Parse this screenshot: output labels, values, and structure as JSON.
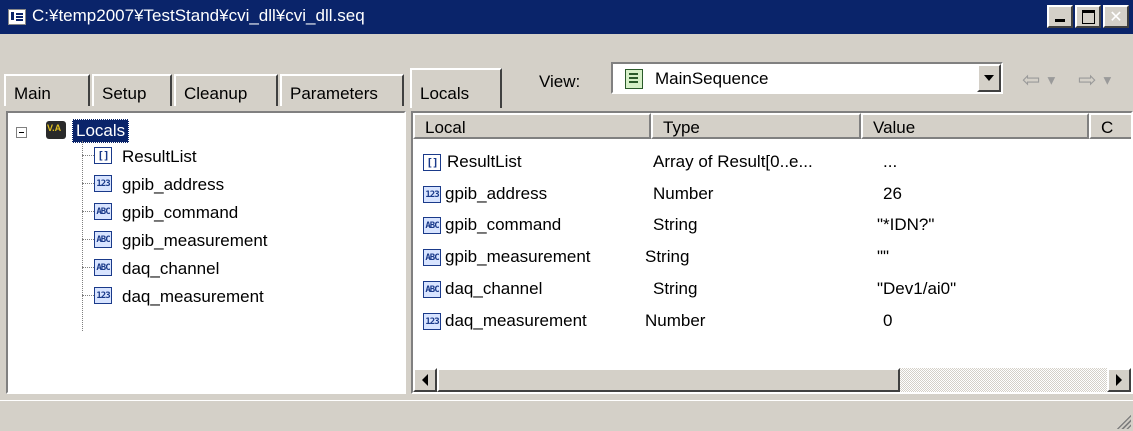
{
  "window": {
    "title": "C:¥temp2007¥TestStand¥cvi_dll¥cvi_dll.seq"
  },
  "tabs": [
    "Main",
    "Setup",
    "Cleanup",
    "Parameters",
    "Locals"
  ],
  "active_tab": "Locals",
  "view": {
    "label": "View:",
    "value": "MainSequence"
  },
  "tree": {
    "root_label": "Locals",
    "items": [
      {
        "label": "ResultList",
        "icon": "array-icon",
        "badge": "[]"
      },
      {
        "label": "gpib_address",
        "icon": "number-icon",
        "badge": "123"
      },
      {
        "label": "gpib_command",
        "icon": "string-icon",
        "badge": "ABC"
      },
      {
        "label": "gpib_measurement",
        "icon": "string-icon",
        "badge": "ABC"
      },
      {
        "label": "daq_channel",
        "icon": "string-icon",
        "badge": "ABC"
      },
      {
        "label": "daq_measurement",
        "icon": "number-icon",
        "badge": "123"
      }
    ]
  },
  "table": {
    "columns": [
      "Local",
      "Type",
      "Value",
      "C"
    ],
    "rows": [
      {
        "name": "ResultList",
        "type": "Array of Result[0..e...",
        "value": "...",
        "badge": "[]"
      },
      {
        "name": "gpib_address",
        "type": "Number",
        "value": "26",
        "badge": "123"
      },
      {
        "name": "gpib_command",
        "type": "String",
        "value": "\"*IDN?\"",
        "badge": "ABC"
      },
      {
        "name": "gpib_measurement",
        "type": "String",
        "value": "\"\"",
        "badge": "ABC"
      },
      {
        "name": "daq_channel",
        "type": "String",
        "value": "\"Dev1/ai0\"",
        "badge": "ABC"
      },
      {
        "name": "daq_measurement",
        "type": "Number",
        "value": "0",
        "badge": "123"
      }
    ]
  },
  "colors": {
    "titlebar": "#0a246a",
    "face": "#d4d0c8"
  }
}
